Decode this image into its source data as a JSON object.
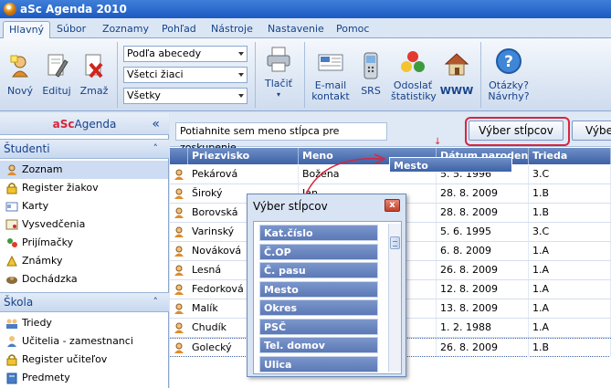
{
  "window": {
    "title": "aSc Agenda 2010"
  },
  "ribbon_tabs": [
    "Hlavný",
    "Súbor",
    "Zoznamy",
    "Pohľad",
    "Nástroje",
    "Nastavenie",
    "Pomoc"
  ],
  "ribbon": {
    "new_label": "Nový",
    "edit_label": "Edituj",
    "delete_label": "Zmaž",
    "sort_combo": "Podľa abecedy",
    "students_combo": "Všetci žiaci",
    "filter_combo": "Všetky",
    "print_label": "Tlačiť",
    "email_label_1": "E-mail",
    "email_label_2": "kontakt",
    "srs_label": "SRS",
    "stats_label_1": "Odoslať",
    "stats_label_2": "štatistiky",
    "www_label": "WWW",
    "help_label_1": "Otázky?",
    "help_label_2": "Návrhy?"
  },
  "nav": {
    "brand_prefix": "aSc",
    "brand_suffix": "Agenda",
    "collapse_symbol": "«",
    "section_students": "Študenti",
    "students_items": [
      "Zoznam",
      "Register žiakov",
      "Karty",
      "Vysvedčenia",
      "Prijímačky",
      "Známky",
      "Dochádzka"
    ],
    "section_school": "Škola",
    "school_items": [
      "Triedy",
      "Učitelia - zamestnanci",
      "Register učiteľov",
      "Predmety"
    ],
    "section_chevron": "˄"
  },
  "grid": {
    "group_hint": "Potiahnite sem meno stĺpca pre zoskupenie",
    "column_chooser_button": "Výber stĺpcov",
    "second_button": "Výber",
    "drag_arrow": "↓",
    "columns": [
      "Priezvisko",
      "Meno",
      "Dátum narodenia",
      "Trieda"
    ],
    "dragging_column": "Mesto",
    "rows": [
      [
        "Pekárová",
        "Božena",
        "5. 5. 1996",
        "3.C"
      ],
      [
        "Široký",
        "Ján",
        "28. 8. 2009",
        "1.B"
      ],
      [
        "Borovská",
        "Ivana",
        "28. 8. 2009",
        "1.B"
      ],
      [
        "Varinský",
        "Peter",
        "5. 6. 1995",
        "3.C"
      ],
      [
        "Nováková",
        "Eva",
        "6. 8. 2009",
        "1.A"
      ],
      [
        "Lesná",
        "Mária",
        "26. 8. 2009",
        "1.A"
      ],
      [
        "Fedorková",
        "Jana",
        "12. 8. 2009",
        "1.A"
      ],
      [
        "Malík",
        "Peter",
        "13. 8. 2009",
        "1.A"
      ],
      [
        "Chudík",
        "Juraj",
        "1. 2. 1988",
        "1.A"
      ],
      [
        "Golecký",
        "Martin",
        "26. 8. 2009",
        "1.B"
      ]
    ]
  },
  "column_chooser": {
    "title": "Výber stĺpcov",
    "close_symbol": "x",
    "items": [
      "Kat.číslo",
      "Č.OP",
      "Č. pasu",
      "Mesto",
      "Okres",
      "PSČ",
      "Tel. domov",
      "Ulica"
    ]
  },
  "colors": {
    "accent": "#15428b",
    "highlight_ring": "#d8253c",
    "header_blue": "#3d61a6"
  }
}
